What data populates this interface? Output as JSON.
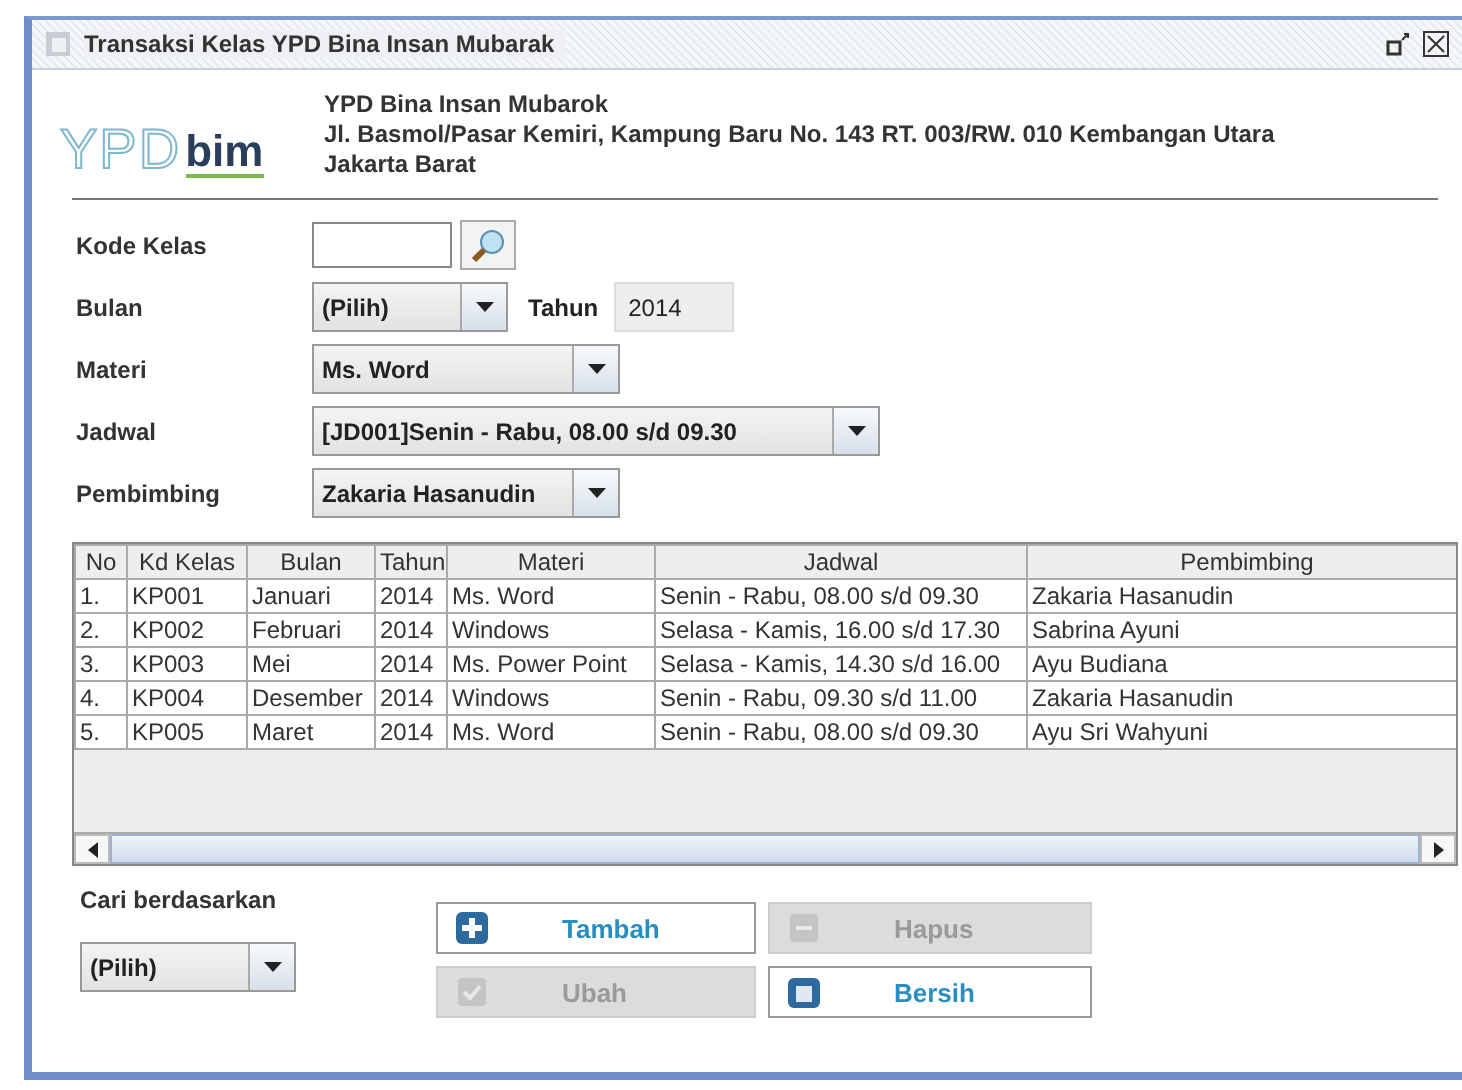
{
  "window": {
    "title": "Transaksi Kelas YPD Bina Insan Mubarak"
  },
  "logo": {
    "outline": "YPD",
    "bold": "bim"
  },
  "header": {
    "name": "YPD Bina Insan Mubarok",
    "address": "Jl. Basmol/Pasar Kemiri, Kampung Baru No. 143 RT. 003/RW. 010 Kembangan Utara",
    "city": "Jakarta Barat"
  },
  "form": {
    "kode_kelas": {
      "label": "Kode Kelas"
    },
    "bulan": {
      "label": "Bulan",
      "value": "(Pilih)"
    },
    "tahun": {
      "label": "Tahun",
      "value": "2014"
    },
    "materi": {
      "label": "Materi",
      "value": "Ms. Word"
    },
    "jadwal": {
      "label": "Jadwal",
      "value": "[JD001]Senin - Rabu, 08.00 s/d 09.30"
    },
    "pembimbing": {
      "label": "Pembimbing",
      "value": "Zakaria Hasanudin"
    }
  },
  "table": {
    "columns": [
      "No",
      "Kd Kelas",
      "Bulan",
      "Tahun",
      "Materi",
      "Jadwal",
      "Pembimbing"
    ],
    "rows": [
      [
        "1.",
        "KP001",
        "Januari",
        "2014",
        "Ms. Word",
        "Senin - Rabu, 08.00 s/d 09.30",
        "Zakaria Hasanudin"
      ],
      [
        "2.",
        "KP002",
        "Februari",
        "2014",
        "Windows",
        "Selasa - Kamis, 16.00 s/d 17.30",
        "Sabrina Ayuni"
      ],
      [
        "3.",
        "KP003",
        "Mei",
        "2014",
        "Ms. Power Point",
        "Selasa - Kamis, 14.30 s/d 16.00",
        "Ayu Budiana"
      ],
      [
        "4.",
        "KP004",
        "Desember",
        "2014",
        "Windows",
        "Senin - Rabu, 09.30 s/d 11.00",
        "Zakaria Hasanudin"
      ],
      [
        "5.",
        "KP005",
        "Maret",
        "2014",
        "Ms. Word",
        "Senin - Rabu, 08.00 s/d 09.30",
        "Ayu Sri Wahyuni"
      ]
    ]
  },
  "search": {
    "label": "Cari berdasarkan",
    "value": "(Pilih)"
  },
  "buttons": [
    {
      "label": "Tambah",
      "kind": "add",
      "disabled": false
    },
    {
      "label": "Hapus",
      "kind": "delete",
      "disabled": true
    },
    {
      "label": "Ubah",
      "kind": "edit",
      "disabled": true
    },
    {
      "label": "Bersih",
      "kind": "clear",
      "disabled": false
    }
  ]
}
